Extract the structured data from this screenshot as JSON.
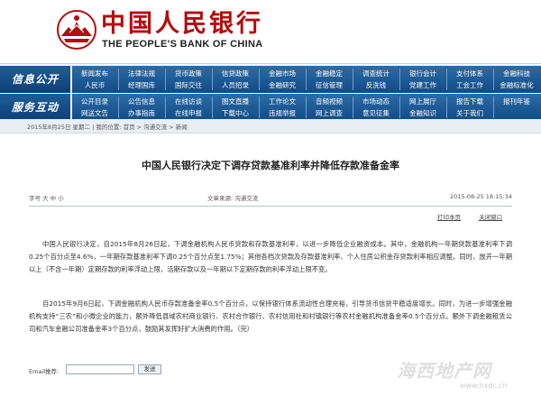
{
  "header": {
    "cn_name": "中国人民银行",
    "en_name": "THE PEOPLE'S BANK OF CHINA",
    "brand_color": "#b40b0b"
  },
  "nav": {
    "row1_title": "信息公开",
    "row1_items": [
      [
        "新闻发布",
        "法律法规",
        "货币政策",
        "信贷政策",
        "金融市场",
        "金融稳定",
        "调查统计",
        "银行会计",
        "支付体系",
        "金融科技"
      ],
      [
        "人民币",
        "经理国库",
        "国际交往",
        "人员招录",
        "金融研究",
        "征信管理",
        "反洗钱",
        "党建工作",
        "工会工作",
        "金融标准化"
      ]
    ],
    "row2_title": "服务互动",
    "row2_items": [
      [
        "公开目录",
        "公告信息",
        "在线访谈",
        "图文直播",
        "工作论文",
        "音频视频",
        "市场动态",
        "网上展厅",
        "报告下载",
        "报刊年鉴"
      ],
      [
        "网送文告",
        "办事指南",
        "在线申报",
        "下载中心",
        "违规举报",
        "网上调查",
        "意见征集",
        "金融知识",
        "关于我们",
        ""
      ]
    ]
  },
  "breadcrumb": "2015年8月25日 星期二 | 我的位置: 首页 > 沟通交流 > 新闻",
  "article": {
    "title": "中国人民银行决定下调存贷款基准利率并降低存款准备金率",
    "font_size_label": "字号 大 中 小",
    "source": "文章来源: 沟通交流",
    "date": "2015-08-25 18:15:34",
    "print_label": "打印本页",
    "close_label": "关闭窗口",
    "paragraph1": "中国人民银行决定，自2015年8月26日起，下调金融机构人民币贷款和存款基准利率，以进一步降低企业融资成本。其中，金融机构一年期贷款基准利率下调0.25个百分点至4.6%，一年期存款基准利率下调0.25个百分点至1.75%；其他各档次贷款及存款基准利率、个人住房公积金存贷款利率相应调整。同时，放开一年期以上（不含一年期）定期存款的利率浮动上限，活期存款以及一年期以下定期存款的利率浮动上限不变。",
    "paragraph2": "自2015年9月6日起，下调金融机构人民币存款准备金率0.5个百分点，以保持银行体系流动性合理充裕，引导货币信贷平稳适度增长。同时，为进一步增强金融机构支持“三农”和小微企业的能力，额外降低县域农村商业银行、农村合作银行、农村信用社和村镇银行等农村金融机构准备金率0.5个百分点。额外下调金融租赁公司和汽车金融公司准备金率3个百分点，鼓励其发挥好扩大消费的作用。（完）",
    "email_label": "Email推荐:",
    "email_value": "",
    "send_label": "发送"
  },
  "watermark": {
    "text": "海西地产网",
    "url": "www.hxdc.cn"
  }
}
